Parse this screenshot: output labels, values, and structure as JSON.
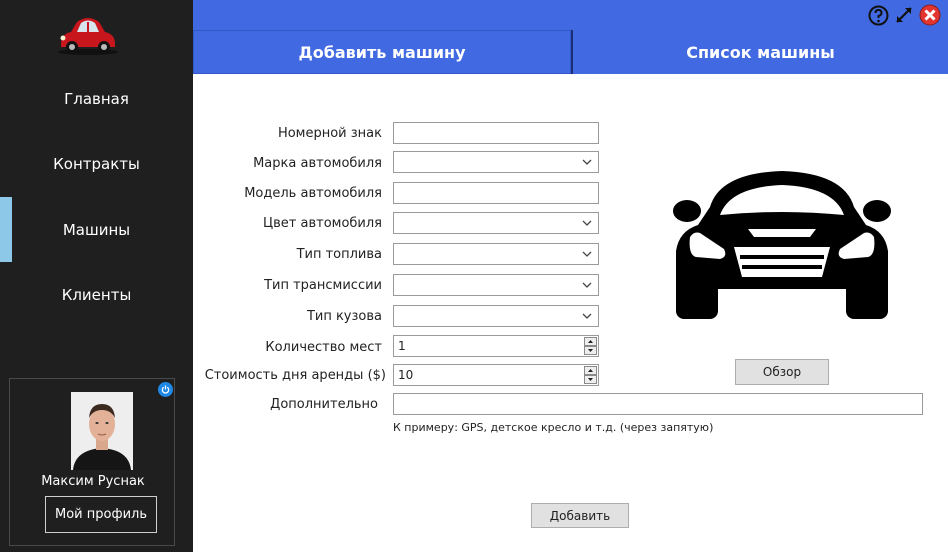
{
  "sidebar": {
    "logo_icon": "red-beetle-car-logo",
    "items": [
      {
        "label": "Главная"
      },
      {
        "label": "Контракты"
      },
      {
        "label": "Машины"
      },
      {
        "label": "Клиенты"
      }
    ],
    "active_item": "Машины"
  },
  "profile": {
    "name": "Максим Руснак",
    "button_label": "Мой профиль"
  },
  "tabs": [
    {
      "label": "Добавить машину"
    },
    {
      "label": "Список машины"
    }
  ],
  "form": {
    "fields": [
      {
        "label": "Номерной знак",
        "type": "text",
        "value": ""
      },
      {
        "label": "Марка автомобиля",
        "type": "select",
        "value": ""
      },
      {
        "label": "Модель автомобиля",
        "type": "text",
        "value": ""
      },
      {
        "label": "Цвет автомобиля",
        "type": "select",
        "value": ""
      },
      {
        "label": "Тип топлива",
        "type": "select",
        "value": ""
      },
      {
        "label": "Тип трансмиссии",
        "type": "select",
        "value": ""
      },
      {
        "label": "Тип кузова",
        "type": "select",
        "value": ""
      },
      {
        "label": "Количество мест",
        "type": "number",
        "value": "1"
      },
      {
        "label": "Стоимость дня аренды ($)",
        "type": "number",
        "value": "10"
      },
      {
        "label": "Дополнительно",
        "type": "text",
        "value": ""
      }
    ],
    "hint": "К примеру: GPS, детское кресло и т.д. (через запятую)",
    "browse_label": "Обзор",
    "submit_label": "Добавить"
  },
  "colors": {
    "sidebar_bg": "#1f1f1f",
    "accent_blue": "#4169e1",
    "active_marker": "#8ec8e8"
  }
}
